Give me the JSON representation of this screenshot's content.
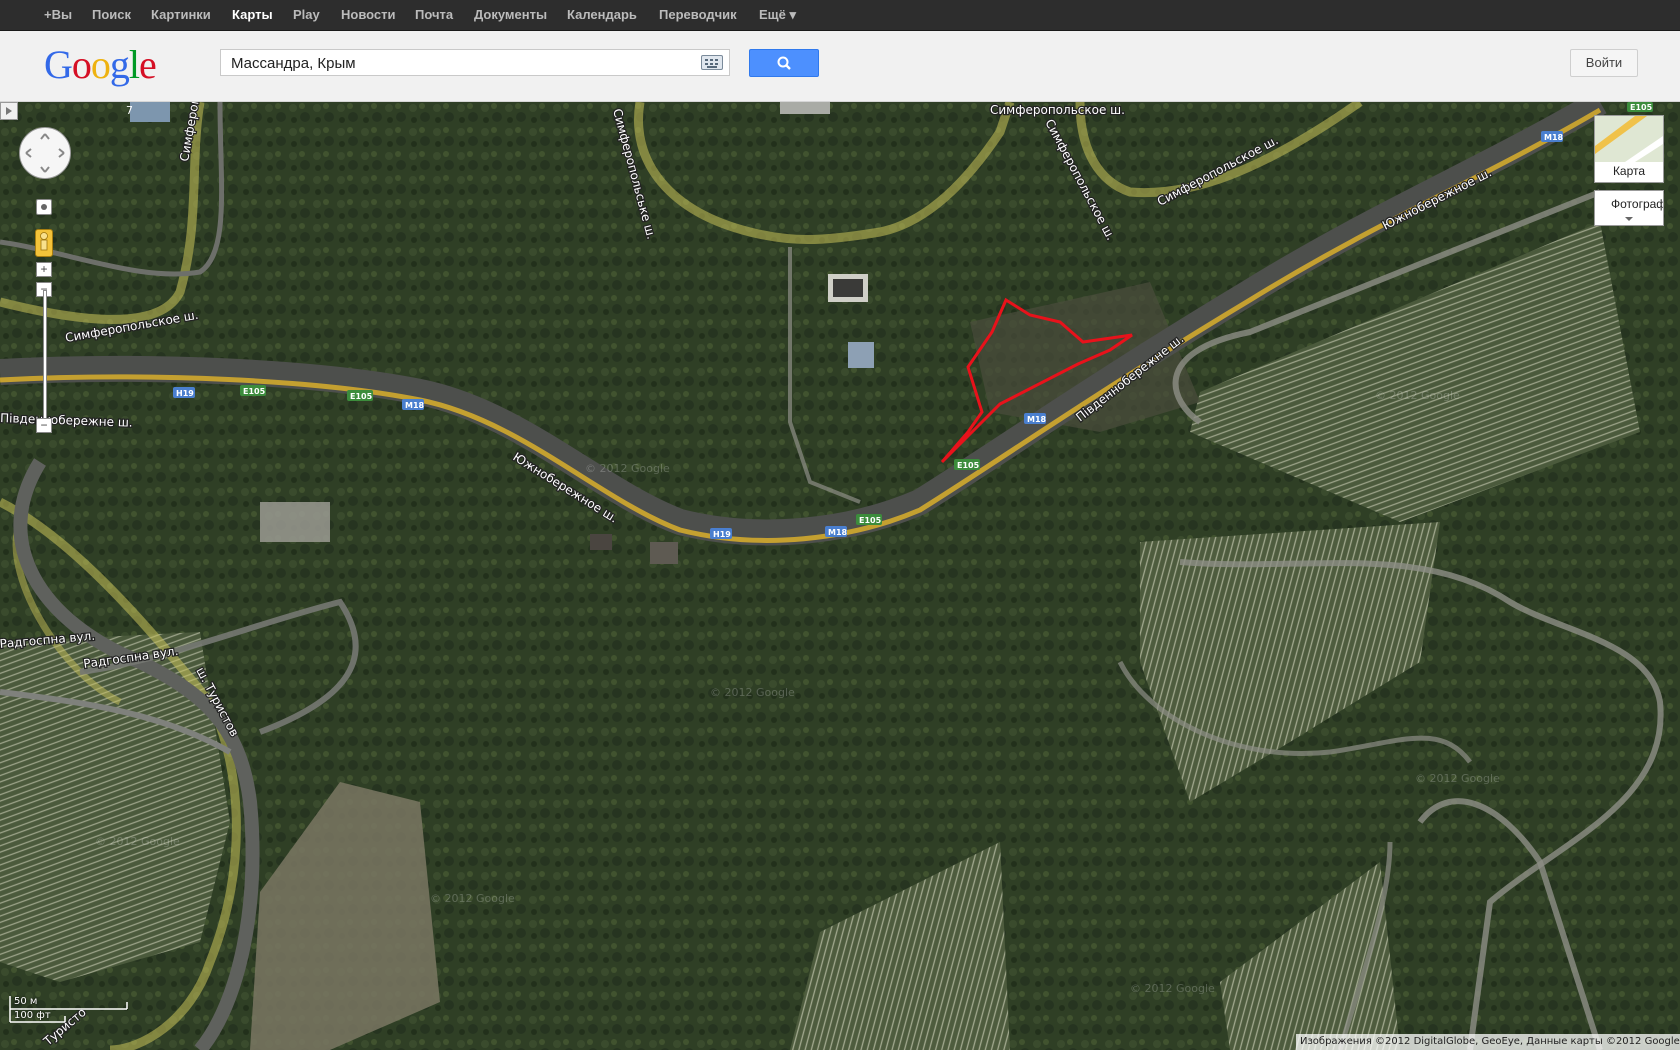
{
  "gbar": {
    "items": [
      {
        "label": "+Вы",
        "active": false
      },
      {
        "label": "Поиск",
        "active": false
      },
      {
        "label": "Картинки",
        "active": false
      },
      {
        "label": "Карты",
        "active": true
      },
      {
        "label": "Play",
        "active": false
      },
      {
        "label": "Новости",
        "active": false
      },
      {
        "label": "Почта",
        "active": false
      },
      {
        "label": "Документы",
        "active": false
      },
      {
        "label": "Календарь",
        "active": false
      },
      {
        "label": "Переводчик",
        "active": false
      },
      {
        "label": "Ещё ▾",
        "active": false
      }
    ]
  },
  "header": {
    "logo": "Google",
    "search_value": "Массандра, Крым",
    "keyboard_icon": "keyboard-icon",
    "search_icon": "search-icon",
    "signin_label": "Войти",
    "accent_color": "#4d90fe"
  },
  "map": {
    "view": "satellite",
    "road_labels": {
      "simferopolskoe_top": "Симферопольское ш.",
      "simferopolskoe_top_right": "Симферопольское ш.",
      "simferopolskoe_vertical": "Симферопольське ш.",
      "simferopolskoe_vertical_2": "Симферопольское ш.",
      "simferopolskoe_left_vertical": "Симферопольское ш.",
      "simferopolskoe_left": "Симферопольское ш.",
      "yuzhnoberezhnoe_main": "Южнобережное ш.",
      "yuzhnoberezhnoe_right": "Южнобережное ш.",
      "pivdennoberezhne": "Південнобережне ш.",
      "pivdennoberezhne_left": "Південнобережне ш.",
      "radgospna_1": "Радгоспна вул.",
      "radgospna_2": "Радгоспна вул.",
      "turistov": "ш. Туристов",
      "turistov_bottom": "Туристо"
    },
    "shields": [
      {
        "text": "H19",
        "color": "#4a7fcf"
      },
      {
        "text": "E105",
        "color": "#3c8c3c"
      },
      {
        "text": "E105",
        "color": "#3c8c3c"
      },
      {
        "text": "M18",
        "color": "#4a7fcf"
      },
      {
        "text": "M18",
        "color": "#4a7fcf"
      },
      {
        "text": "E105",
        "color": "#3c8c3c"
      },
      {
        "text": "E105",
        "color": "#3c8c3c"
      },
      {
        "text": "H19",
        "color": "#4a7fcf"
      },
      {
        "text": "M18",
        "color": "#4a7fcf"
      },
      {
        "text": "M18",
        "color": "#4a7fcf"
      },
      {
        "text": "E105",
        "color": "#3c8c3c"
      }
    ],
    "watermark": "© 2012 Google",
    "marker_number": "7",
    "highlight_color": "#e8121b"
  },
  "controls": {
    "layer_map_label": "Карта",
    "layer_sat_label": "Фотограф",
    "scale_metric": "50 м",
    "scale_imperial": "100 фт",
    "pan_icon": "pan-control-icon",
    "zoom_in": "+",
    "zoom_out": "−",
    "pegman_icon": "pegman-icon"
  },
  "copyright": "Изображения ©2012 DigitalGlobe, GeoEye, Данные карты ©2012 Google -"
}
